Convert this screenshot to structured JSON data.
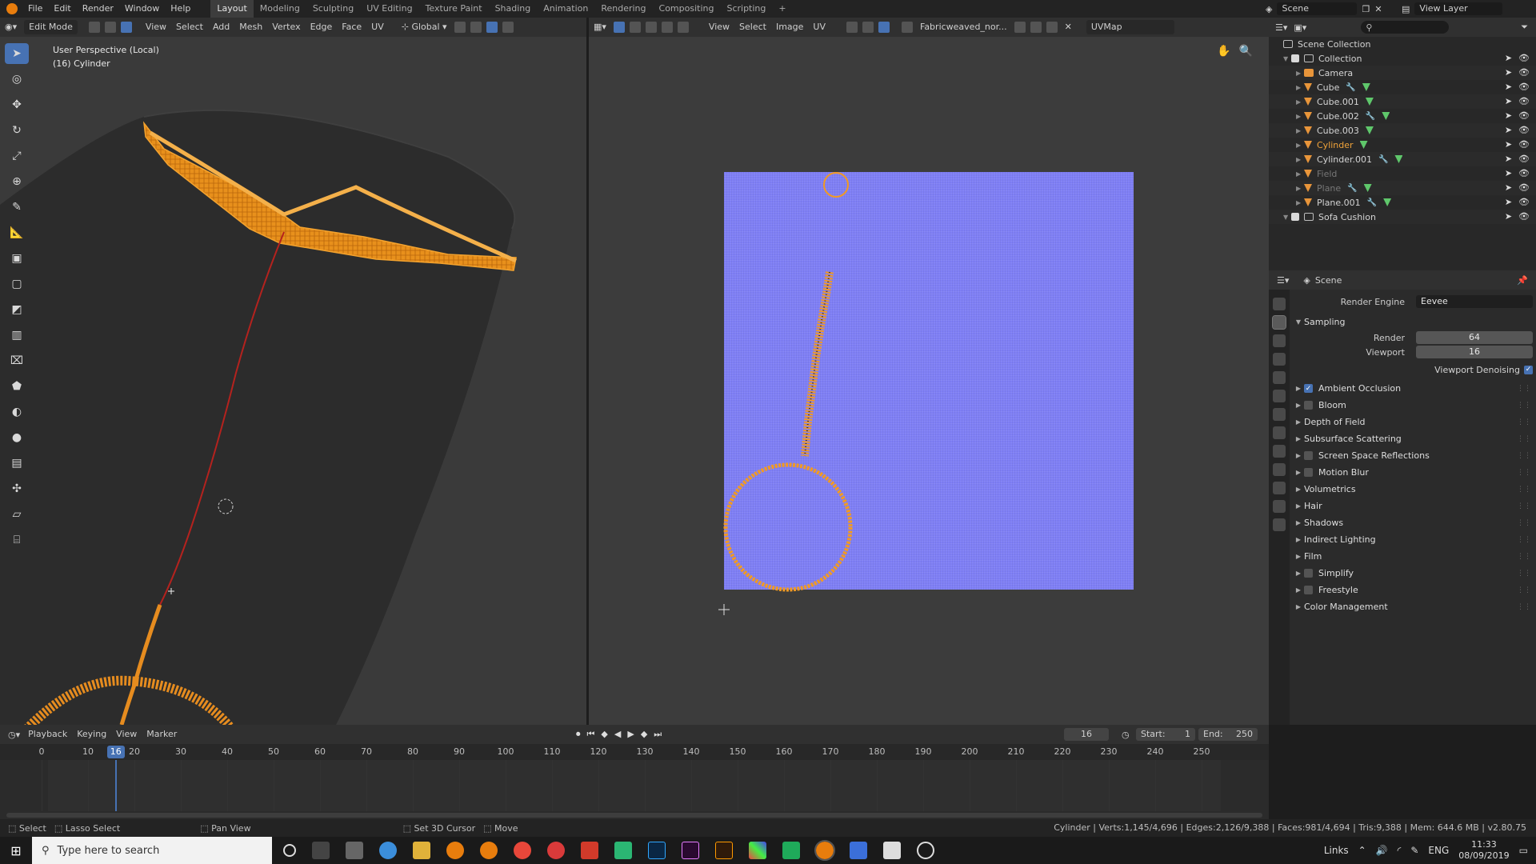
{
  "topbar": {
    "menus": [
      "File",
      "Edit",
      "Render",
      "Window",
      "Help"
    ],
    "workspaces": [
      "Layout",
      "Modeling",
      "Sculpting",
      "UV Editing",
      "Texture Paint",
      "Shading",
      "Animation",
      "Rendering",
      "Compositing",
      "Scripting"
    ],
    "active_workspace": "Layout",
    "add_tab": "+",
    "scene_label": "Scene",
    "view_layer_label": "View Layer"
  },
  "viewport3d": {
    "mode": "Edit Mode",
    "menus": [
      "View",
      "Select",
      "Add",
      "Mesh",
      "Vertex",
      "Edge",
      "Face",
      "UV"
    ],
    "transform_orientation": "Global",
    "overlay_line1": "User Perspective (Local)",
    "overlay_line2": "(16) Cylinder",
    "tools": [
      "select-box",
      "cursor",
      "move",
      "rotate",
      "scale",
      "transform",
      "annotate",
      "measure",
      "extrude",
      "inset",
      "bevel",
      "loop-cut",
      "knife",
      "poly-build",
      "spin",
      "smooth",
      "edge-slide",
      "shrink-fatten",
      "shear",
      "rip"
    ]
  },
  "uv_editor": {
    "menus": [
      "View",
      "Select",
      "Image",
      "UV"
    ],
    "image_name": "Fabricweaved_nor...",
    "uv_map": "UVMap",
    "colors": {
      "texture": "#7f7ff5",
      "selection": "#f19a24"
    }
  },
  "outliner": {
    "root": "Scene Collection",
    "items": [
      {
        "name": "Collection",
        "type": "collection",
        "depth": 1
      },
      {
        "name": "Camera",
        "type": "camera",
        "depth": 2
      },
      {
        "name": "Cube",
        "type": "mesh",
        "depth": 2,
        "mod": true
      },
      {
        "name": "Cube.001",
        "type": "mesh",
        "depth": 2
      },
      {
        "name": "Cube.002",
        "type": "mesh",
        "depth": 2,
        "mod": true
      },
      {
        "name": "Cube.003",
        "type": "mesh",
        "depth": 2
      },
      {
        "name": "Cylinder",
        "type": "mesh",
        "depth": 2,
        "selected": true
      },
      {
        "name": "Cylinder.001",
        "type": "mesh",
        "depth": 2,
        "mod": true
      },
      {
        "name": "Field",
        "type": "field",
        "depth": 2,
        "dim": true
      },
      {
        "name": "Plane",
        "type": "mesh",
        "depth": 2,
        "dim": true,
        "mod": true
      },
      {
        "name": "Plane.001",
        "type": "mesh",
        "depth": 2,
        "mod": true
      },
      {
        "name": "Sofa Cushion",
        "type": "collection",
        "depth": 1
      }
    ]
  },
  "properties": {
    "context": "Scene",
    "render_engine_label": "Render Engine",
    "render_engine": "Eevee",
    "sampling_label": "Sampling",
    "render_label": "Render",
    "render_samples": "64",
    "viewport_label": "Viewport",
    "viewport_samples": "16",
    "denoise_label": "Viewport Denoising",
    "panels": [
      {
        "label": "Ambient Occlusion",
        "checkbox": true,
        "checked": true
      },
      {
        "label": "Bloom",
        "checkbox": true,
        "checked": false
      },
      {
        "label": "Depth of Field",
        "checkbox": false
      },
      {
        "label": "Subsurface Scattering",
        "checkbox": false
      },
      {
        "label": "Screen Space Reflections",
        "checkbox": true,
        "checked": false
      },
      {
        "label": "Motion Blur",
        "checkbox": true,
        "checked": false
      },
      {
        "label": "Volumetrics",
        "checkbox": false
      },
      {
        "label": "Hair",
        "checkbox": false
      },
      {
        "label": "Shadows",
        "checkbox": false
      },
      {
        "label": "Indirect Lighting",
        "checkbox": false
      },
      {
        "label": "Film",
        "checkbox": false
      },
      {
        "label": "Simplify",
        "checkbox": true,
        "checked": false
      },
      {
        "label": "Freestyle",
        "checkbox": true,
        "checked": false
      },
      {
        "label": "Color Management",
        "checkbox": false
      }
    ]
  },
  "timeline": {
    "menus": [
      "Playback",
      "Keying",
      "View",
      "Marker"
    ],
    "current_frame": "16",
    "start_label": "Start:",
    "start": "1",
    "end_label": "End:",
    "end": "250",
    "ticks": [
      0,
      10,
      20,
      30,
      40,
      50,
      60,
      70,
      80,
      90,
      100,
      110,
      120,
      130,
      140,
      150,
      160,
      170,
      180,
      190,
      200,
      210,
      220,
      230,
      240,
      250
    ]
  },
  "statusbar": {
    "items": [
      "Select",
      "Lasso Select",
      "Pan View",
      "Set 3D Cursor",
      "Move"
    ],
    "stats": "Cylinder | Verts:1,145/4,696 | Edges:2,126/9,388 | Faces:981/4,694 | Tris:9,388 | Mem: 644.6 MB | v2.80.75"
  },
  "taskbar": {
    "search_placeholder": "Type here to search",
    "tray_links": "Links",
    "language": "ENG",
    "time": "11:33",
    "date": "08/09/2019"
  }
}
